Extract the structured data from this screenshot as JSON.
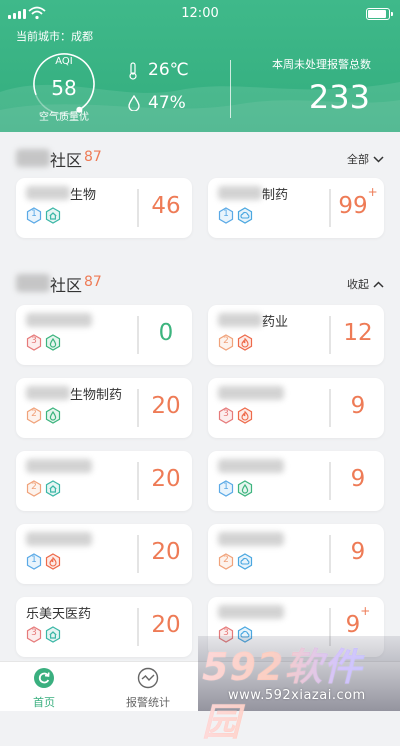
{
  "status_bar": {
    "time": "12:00"
  },
  "header": {
    "city_label": "当前城市：成都",
    "aqi": {
      "label": "AQI",
      "value": "58",
      "quality": "空气质量优",
      "ring_fraction": 0.72
    },
    "temperature": "26℃",
    "humidity": "47%",
    "alarm_title": "本周未处理报警总数",
    "alarm_total": "233"
  },
  "sections": [
    {
      "name": "社区",
      "count": "87",
      "action": "全部",
      "action_icon": "chevron-down-icon",
      "cards": [
        {
          "name": "生物",
          "value": "46",
          "badges": [
            {
              "text": "1",
              "type": "level",
              "color": "#5aa9e6"
            },
            {
              "type": "home-icon",
              "color": "#3bb7a6"
            }
          ]
        },
        {
          "name": "制药",
          "value": "99",
          "suffix": "+",
          "badges": [
            {
              "text": "1",
              "type": "level",
              "color": "#5aa9e6"
            },
            {
              "type": "cloud-icon",
              "color": "#4aa7e0"
            }
          ]
        }
      ]
    },
    {
      "name": "社区",
      "count": "87",
      "action": "收起",
      "action_icon": "chevron-up-icon",
      "cards": [
        {
          "name": "",
          "value": "0",
          "value_color": "green",
          "badges": [
            {
              "text": "3",
              "type": "level",
              "color": "#e67a7a"
            },
            {
              "type": "drop-icon",
              "color": "#3cb47e"
            }
          ]
        },
        {
          "name": "药业",
          "value": "12",
          "badges": [
            {
              "text": "2",
              "type": "level",
              "color": "#f0a27a"
            },
            {
              "type": "fire-icon",
              "color": "#ee6a4a"
            }
          ]
        },
        {
          "name": "生物制药",
          "value": "20",
          "badges": [
            {
              "text": "2",
              "type": "level",
              "color": "#f0a27a"
            },
            {
              "type": "drop-icon",
              "color": "#3cb47e"
            }
          ]
        },
        {
          "name": "",
          "value": "9",
          "badges": [
            {
              "text": "3",
              "type": "level",
              "color": "#e67a7a"
            },
            {
              "type": "fire-icon",
              "color": "#ee6a4a"
            }
          ]
        },
        {
          "name": "",
          "value": "20",
          "badges": [
            {
              "text": "2",
              "type": "level",
              "color": "#f0a27a"
            },
            {
              "type": "home-icon",
              "color": "#3bb7a6"
            }
          ]
        },
        {
          "name": "",
          "value": "9",
          "badges": [
            {
              "text": "1",
              "type": "level",
              "color": "#5aa9e6"
            },
            {
              "type": "drop-icon",
              "color": "#3cb47e"
            }
          ]
        },
        {
          "name": "",
          "value": "20",
          "badges": [
            {
              "text": "1",
              "type": "level",
              "color": "#5aa9e6"
            },
            {
              "type": "fire-icon",
              "color": "#ee6a4a"
            }
          ]
        },
        {
          "name": "",
          "value": "9",
          "badges": [
            {
              "text": "2",
              "type": "level",
              "color": "#f0a27a"
            },
            {
              "type": "cloud-icon",
              "color": "#4aa7e0"
            }
          ]
        },
        {
          "name": "乐美天医药",
          "value": "20",
          "badges": [
            {
              "text": "3",
              "type": "level",
              "color": "#e67a7a"
            },
            {
              "type": "home-icon",
              "color": "#3bb7a6"
            }
          ]
        },
        {
          "name": "",
          "value": "9",
          "suffix": "+",
          "badges": [
            {
              "text": "3",
              "type": "level",
              "color": "#e67a7a"
            },
            {
              "type": "cloud-icon",
              "color": "#4aa7e0"
            }
          ]
        }
      ]
    }
  ],
  "tabs": [
    {
      "label": "首页",
      "icon": "refresh-icon",
      "active": true
    },
    {
      "label": "报警统计",
      "icon": "chart-line-icon",
      "active": false
    }
  ],
  "watermark": {
    "brand": "592软件园",
    "url": "www.592xiazai.com"
  },
  "colors": {
    "primary": "#3cb47e",
    "alarm": "#ee7b56"
  }
}
